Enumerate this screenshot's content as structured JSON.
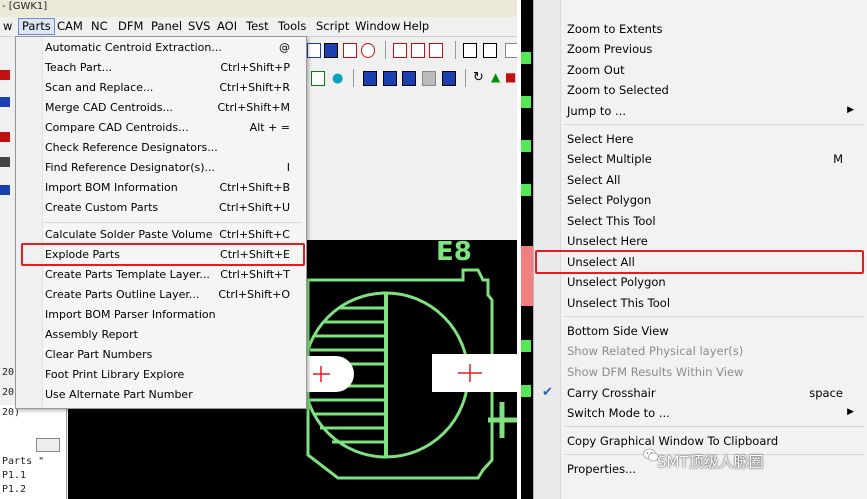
{
  "window": {
    "title": "- [GWK1]"
  },
  "menubar": {
    "items": [
      {
        "label": "w"
      },
      {
        "label": "Parts"
      },
      {
        "label": "CAM"
      },
      {
        "label": "NC"
      },
      {
        "label": "DFM"
      },
      {
        "label": "Panel"
      },
      {
        "label": "SVS"
      },
      {
        "label": "AOI"
      },
      {
        "label": "Test"
      },
      {
        "label": "Tools"
      },
      {
        "label": "Script"
      },
      {
        "label": "Window"
      },
      {
        "label": "Help"
      }
    ]
  },
  "parts_menu": {
    "items": [
      {
        "label": "Automatic Centroid Extraction...",
        "shortcut": "@"
      },
      {
        "label": "Teach Part...",
        "shortcut": "Ctrl+Shift+P"
      },
      {
        "label": "Scan and Replace...",
        "shortcut": "Ctrl+Shift+R"
      },
      {
        "label": "Merge CAD Centroids...",
        "shortcut": "Ctrl+Shift+M"
      },
      {
        "label": "Compare CAD Centroids...",
        "shortcut": "Alt + ="
      },
      {
        "label": "Check Reference Designators...",
        "shortcut": ""
      },
      {
        "label": "Find Reference Designator(s)...",
        "shortcut": "I"
      },
      {
        "label": "Import BOM Information",
        "shortcut": "Ctrl+Shift+B"
      },
      {
        "label": "Create Custom Parts",
        "shortcut": "Ctrl+Shift+U"
      },
      {
        "label": "Calculate Solder Paste Volume",
        "shortcut": "Ctrl+Shift+C"
      },
      {
        "label": "Explode Parts",
        "shortcut": "Ctrl+Shift+E"
      },
      {
        "label": "Create Parts Template Layer...",
        "shortcut": "Ctrl+Shift+T"
      },
      {
        "label": "Create Parts Outline Layer...",
        "shortcut": "Ctrl+Shift+O"
      },
      {
        "label": "Import BOM Parser Information",
        "shortcut": ""
      },
      {
        "label": "Assembly Report",
        "shortcut": ""
      },
      {
        "label": "Clear Part Numbers",
        "shortcut": ""
      },
      {
        "label": "Foot Print Library Explore",
        "shortcut": ""
      },
      {
        "label": "Use Alternate Part Number",
        "shortcut": ""
      }
    ]
  },
  "canvas": {
    "designator": "E8"
  },
  "left_panel": {
    "lines": [
      "20)",
      "20)",
      "20)",
      "Parts \"",
      "P1.1",
      "P1.2"
    ]
  },
  "context_menu": {
    "items": [
      {
        "label": "Zoom to Extents",
        "shortcut": "",
        "disabled": false
      },
      {
        "label": "Zoom Previous",
        "shortcut": "",
        "disabled": false
      },
      {
        "label": "Zoom Out",
        "shortcut": "",
        "disabled": false
      },
      {
        "label": "Zoom to Selected",
        "shortcut": "",
        "disabled": false
      },
      {
        "label": "Jump to ...",
        "shortcut": "",
        "disabled": false
      },
      {
        "label": "Select Here",
        "shortcut": "",
        "disabled": false
      },
      {
        "label": "Select Multiple",
        "shortcut": "M",
        "disabled": false
      },
      {
        "label": "Select All",
        "shortcut": "",
        "disabled": false
      },
      {
        "label": "Select Polygon",
        "shortcut": "",
        "disabled": false
      },
      {
        "label": "Select This Tool",
        "shortcut": "",
        "disabled": false
      },
      {
        "label": "Unselect Here",
        "shortcut": "",
        "disabled": false
      },
      {
        "label": "Unselect All",
        "shortcut": "",
        "disabled": false
      },
      {
        "label": "Unselect Polygon",
        "shortcut": "",
        "disabled": false
      },
      {
        "label": "Unselect This Tool",
        "shortcut": "",
        "disabled": false
      },
      {
        "label": "Bottom Side View",
        "shortcut": "",
        "disabled": false
      },
      {
        "label": "Show Related Physical layer(s)",
        "shortcut": "",
        "disabled": true
      },
      {
        "label": "Show DFM Results Within View",
        "shortcut": "",
        "disabled": true
      },
      {
        "label": "Carry Crosshair",
        "shortcut": "space",
        "disabled": false
      },
      {
        "label": "Switch Mode to ...",
        "shortcut": "",
        "disabled": false
      },
      {
        "label": "Copy Graphical Window To Clipboard",
        "shortcut": "",
        "disabled": false
      },
      {
        "label": "Properties...",
        "shortcut": "",
        "disabled": false
      }
    ]
  },
  "watermark": {
    "text": "SMT顶级人脉圈"
  },
  "colors": {
    "highlight": "#e02020",
    "pcb_green": "#7ee27e",
    "canvas_bg": "#000000"
  }
}
